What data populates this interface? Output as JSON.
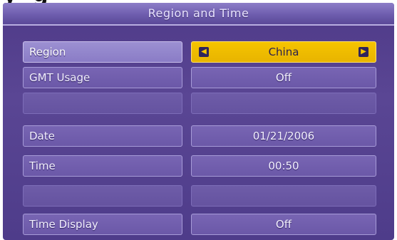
{
  "page_heading_fragment": {
    "left": "y",
    "right": "g"
  },
  "window": {
    "title": "Region and Time"
  },
  "settings": [
    {
      "label": "Region",
      "value": "China",
      "state": "selected"
    },
    {
      "label": "GMT Usage",
      "value": "Off",
      "state": "normal"
    },
    {
      "label": "",
      "value": "",
      "state": "disabled"
    },
    {
      "label": "Date",
      "value": "01/21/2006",
      "state": "normal"
    },
    {
      "label": "Time",
      "value": "00:50",
      "state": "normal"
    },
    {
      "label": "",
      "value": "",
      "state": "disabled"
    },
    {
      "label": "Time Display",
      "value": "Off",
      "state": "normal"
    }
  ],
  "icons": {
    "prev": "arrow-left-icon",
    "next": "arrow-right-icon"
  },
  "colors": {
    "panel": "#55408f",
    "highlight": "#f5c400",
    "row": "#735fae",
    "text": "#f4f1ff"
  }
}
